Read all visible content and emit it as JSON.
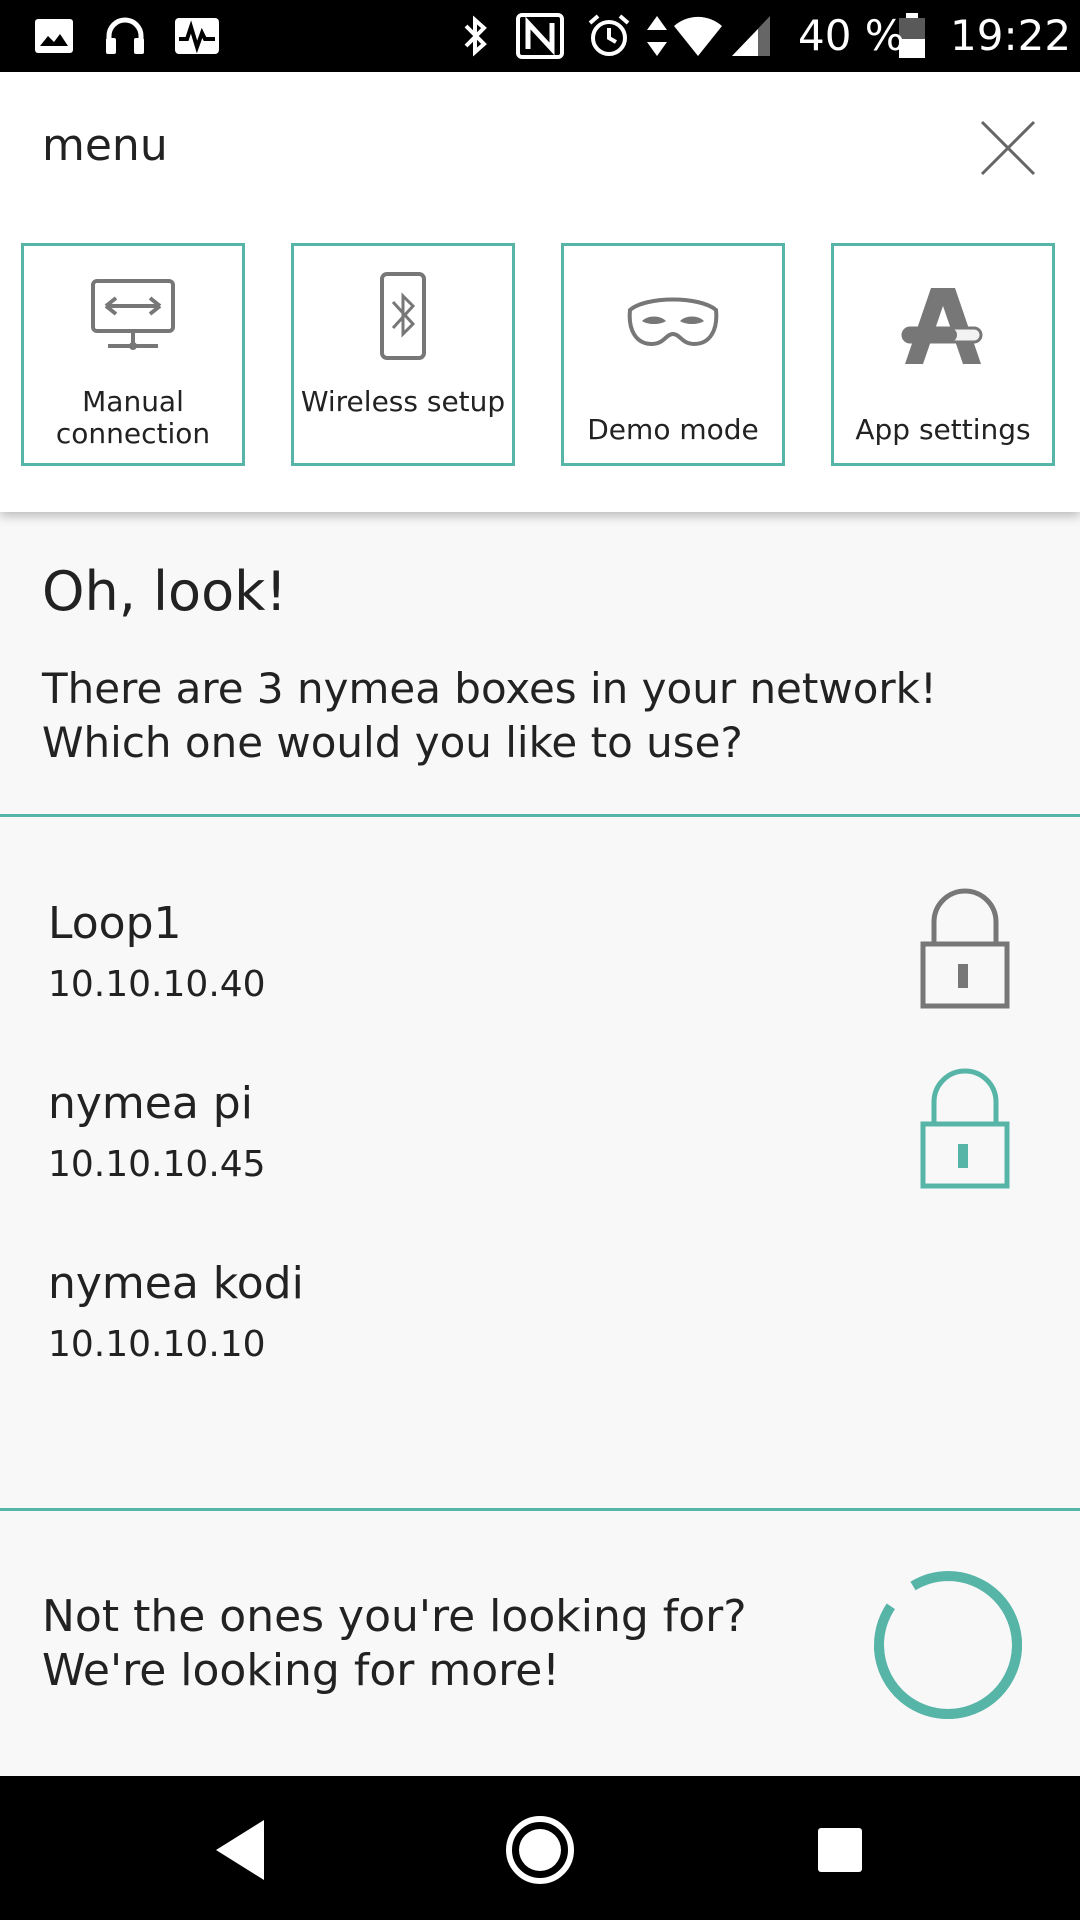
{
  "status_bar": {
    "battery_text": "40 %",
    "time": "19:22",
    "icons_left": [
      "image-icon",
      "headphones-icon",
      "activity-icon"
    ],
    "icons_right": [
      "bluetooth-icon",
      "nfc-icon",
      "alarm-icon",
      "data-arrows-icon",
      "wifi-icon",
      "signal-icon",
      "battery-icon"
    ]
  },
  "menu": {
    "title": "menu",
    "tiles": [
      {
        "label": "Manual connection",
        "icon": "monitor-arrows-icon"
      },
      {
        "label": "Wireless setup",
        "icon": "bluetooth-device-icon"
      },
      {
        "label": "Demo mode",
        "icon": "mask-icon"
      },
      {
        "label": "App settings",
        "icon": "app-settings-icon"
      }
    ]
  },
  "main": {
    "heading": "Oh, look!",
    "question": "There are 3 nymea boxes in your network! Which one would you like to use?",
    "boxes": [
      {
        "name": "Loop1",
        "ip": "10.10.10.40",
        "lock": "gray"
      },
      {
        "name": "nymea pi",
        "ip": "10.10.10.45",
        "lock": "teal"
      },
      {
        "name": "nymea kodi",
        "ip": "10.10.10.10",
        "lock": "none"
      }
    ],
    "footer": "Not the ones you're looking for? We're looking for more!"
  },
  "colors": {
    "accent": "#57b5a8",
    "lock_gray": "#777777",
    "background": "#f8f8f8"
  }
}
